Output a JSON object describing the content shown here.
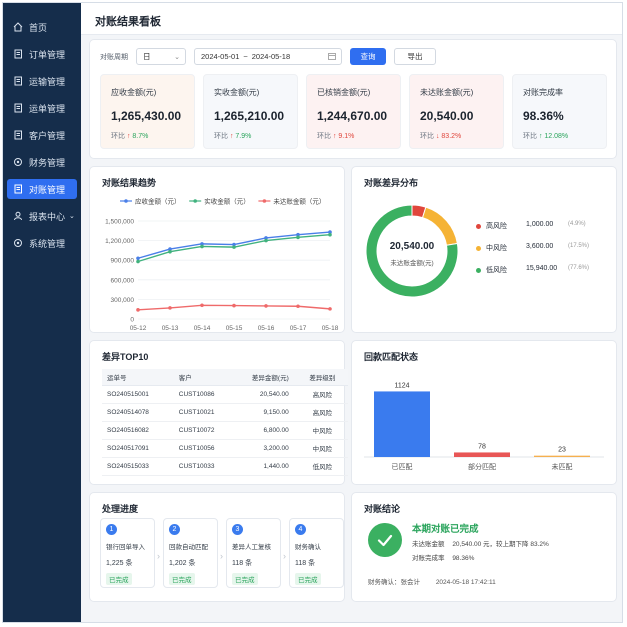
{
  "nav": {
    "items": [
      {
        "label": "首页",
        "icon": "home-icon"
      },
      {
        "label": "订单管理",
        "icon": "document-icon"
      },
      {
        "label": "运输管理",
        "icon": "document-icon"
      },
      {
        "label": "运单管理",
        "icon": "document-icon"
      },
      {
        "label": "客户管理",
        "icon": "document-icon"
      },
      {
        "label": "财务管理",
        "icon": "settings-icon"
      },
      {
        "label": "对账管理",
        "icon": "document-icon"
      },
      {
        "label": "报表中心",
        "icon": "user-icon"
      },
      {
        "label": "系统管理",
        "icon": "settings-icon"
      }
    ],
    "active_index": 6
  },
  "page": {
    "title": "对账结果看板"
  },
  "filters": {
    "period_label": "对账周期",
    "period_value": "日",
    "date_start": "2024-05-01",
    "date_sep": "~",
    "date_end": "2024-05-18",
    "query_label": "查询",
    "export_label": "导出"
  },
  "kpis": [
    {
      "label": "应收金额(元)",
      "value": "1,265,430.00",
      "cmp_label": "环比",
      "arrow": "↑",
      "change": "8.7%",
      "trend": "up",
      "tint": "#fdf5ef"
    },
    {
      "label": "实收金额(元)",
      "value": "1,265,210.00",
      "cmp_label": "环比",
      "arrow": "↑",
      "change": "7.9%",
      "trend": "up",
      "tint": "#f6f8fb"
    },
    {
      "label": "已核销金额(元)",
      "value": "1,244,670.00",
      "cmp_label": "环比",
      "arrow": "↑",
      "change": "9.1%",
      "trend": "up",
      "tint": "#fdf2f2"
    },
    {
      "label": "未达账金额(元)",
      "value": "20,540.00",
      "cmp_label": "环比",
      "arrow": "↓",
      "change": "83.2%",
      "trend": "down",
      "tint": "#fdf2f2"
    },
    {
      "label": "对账完成率",
      "value": "98.36%",
      "cmp_label": "环比",
      "arrow": "↑",
      "change": "12.08%",
      "trend": "green",
      "tint": "#f6f8fb"
    }
  ],
  "trend_card": {
    "title": "对账结果趋势"
  },
  "distribution_card": {
    "title": "对账差异分布",
    "center_value": "20,540.00",
    "center_label": "未达账金额(元)",
    "legend": [
      {
        "name": "高风险",
        "value": "1,000.00",
        "pct": "(4.9%)",
        "color": "#e0463c"
      },
      {
        "name": "中风险",
        "value": "3,600.00",
        "pct": "(17.5%)",
        "color": "#f5b335"
      },
      {
        "name": "低风险",
        "value": "15,940.00",
        "pct": "(77.6%)",
        "color": "#3bb061"
      }
    ]
  },
  "top10": {
    "title": "差异TOP10",
    "headers": [
      "运单号",
      "客户",
      "差异金额(元)",
      "差异级别"
    ],
    "rows": [
      {
        "id": "SO240515001",
        "customer": "CUST10086",
        "amount": "20,540.00",
        "level": "高风险",
        "cls": "risk-h"
      },
      {
        "id": "SO240514078",
        "customer": "CUST10021",
        "amount": "9,150.00",
        "level": "高风险",
        "cls": "risk-h"
      },
      {
        "id": "SO240516082",
        "customer": "CUST10072",
        "amount": "6,800.00",
        "level": "中风险",
        "cls": "risk-m"
      },
      {
        "id": "SO240517091",
        "customer": "CUST10056",
        "amount": "3,200.00",
        "level": "中风险",
        "cls": "risk-m"
      },
      {
        "id": "SO240515033",
        "customer": "CUST10033",
        "amount": "1,440.00",
        "level": "低风险",
        "cls": "risk-l"
      }
    ]
  },
  "match_card": {
    "title": "回款匹配状态"
  },
  "progress": {
    "title": "处理进度",
    "steps": [
      {
        "num": "1",
        "name": "银行回单导入",
        "count": "1,225 条",
        "status": "已完成"
      },
      {
        "num": "2",
        "name": "回款自动匹配",
        "count": "1,202 条",
        "status": "已完成"
      },
      {
        "num": "3",
        "name": "差异人工复核",
        "count": "118 条",
        "status": "已完成"
      },
      {
        "num": "4",
        "name": "财务确认",
        "count": "118 条",
        "status": "已完成"
      }
    ]
  },
  "conclusion": {
    "title": "对账结论",
    "headline": "本期对账已完成",
    "line1_label": "未达账金额",
    "line1_value": "20,540.00 元，较上期下降 83.2%",
    "line2_label": "对账完成率",
    "line2_value": "98.36%",
    "confirm_label": "财务确认：",
    "confirm_name": "张会计",
    "confirm_time": "2024-05-18 17:42:11"
  },
  "chart_data": [
    {
      "type": "line",
      "x": [
        "05-12",
        "05-13",
        "05-14",
        "05-15",
        "05-16",
        "05-17",
        "05-18"
      ],
      "series": [
        {
          "name": "应收金额（元）",
          "color": "#4a7fe8",
          "values": [
            930000,
            1070000,
            1150000,
            1140000,
            1240000,
            1290000,
            1330000
          ]
        },
        {
          "name": "实收金额（元）",
          "color": "#41b27e",
          "values": [
            880000,
            1030000,
            1110000,
            1100000,
            1200000,
            1250000,
            1290000
          ]
        },
        {
          "name": "未达账金额（元）",
          "color": "#ef6a6a",
          "values": [
            140000,
            170000,
            210000,
            205000,
            200000,
            195000,
            155000
          ]
        }
      ],
      "yticks": [
        "0",
        "300,000",
        "600,000",
        "900,000",
        "1,200,000",
        "1,500,000"
      ],
      "ylim": [
        0,
        1500000
      ],
      "legend": "top"
    },
    {
      "type": "pie",
      "categories": [
        "高风险",
        "中风险",
        "低风险"
      ],
      "values": [
        1000,
        3600,
        15940
      ],
      "colors": [
        "#e0463c",
        "#f5b335",
        "#3bb061"
      ]
    },
    {
      "type": "bar",
      "categories": [
        "已匹配",
        "部分匹配",
        "未匹配"
      ],
      "values": [
        1124,
        78,
        23
      ],
      "colors": [
        "#3a7bee",
        "#e85656",
        "#f5b050"
      ],
      "ylim": [
        0,
        1200
      ]
    }
  ]
}
